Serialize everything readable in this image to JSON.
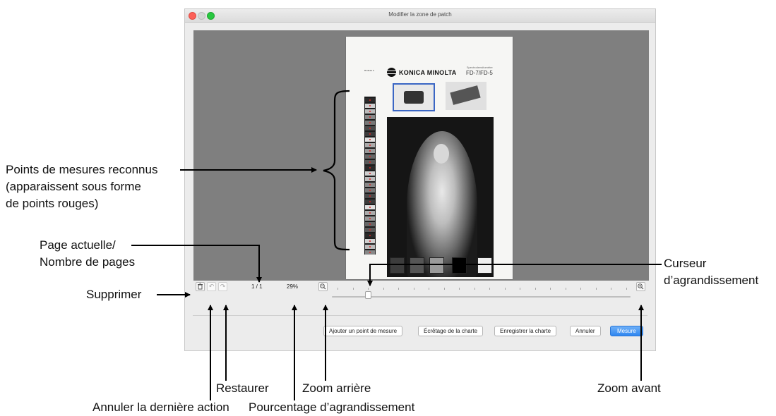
{
  "window": {
    "title": "Modifier la zone de patch"
  },
  "chart_page": {
    "brand": "KONICA MINOLTA",
    "model": "FD-7/FD-5",
    "model_caption": "Spectrodensitomètre",
    "sheet_label": "Rouleau A"
  },
  "toolbar": {
    "page_indicator": "1 / 1",
    "zoom_percent": "29%",
    "zoom_level": 0.12
  },
  "buttons": {
    "add_point": "Ajouter un point de mesure",
    "crop_chart": "Écrêtage de la charte",
    "save_chart": "Enregistrer la charte",
    "cancel": "Annuler",
    "measure": "Mesure"
  },
  "annotations": {
    "recognized_points_1": "Points de mesures reconnus",
    "recognized_points_2": "(apparaissent sous forme",
    "recognized_points_3": "de points rouges)",
    "page_count_1": "Page actuelle/",
    "page_count_2": "Nombre de pages",
    "delete": "Supprimer",
    "zoom_slider_1": "Curseur",
    "zoom_slider_2": "d’agrandissement",
    "restore": "Restaurer",
    "zoom_out": "Zoom arrière",
    "zoom_in": "Zoom avant",
    "undo_last": "Annuler la dernière action",
    "zoom_percentage": "Pourcentage d’agrandissement"
  },
  "icons": {
    "delete": "trash-icon",
    "undo": "undo-icon",
    "redo": "redo-icon",
    "zoom_out": "zoom-out-icon",
    "zoom_in": "zoom-in-icon"
  },
  "colors": {
    "primary_button": "#2f86f0",
    "canvas": "#7f7f7f",
    "patch_marker": "#e02020"
  }
}
